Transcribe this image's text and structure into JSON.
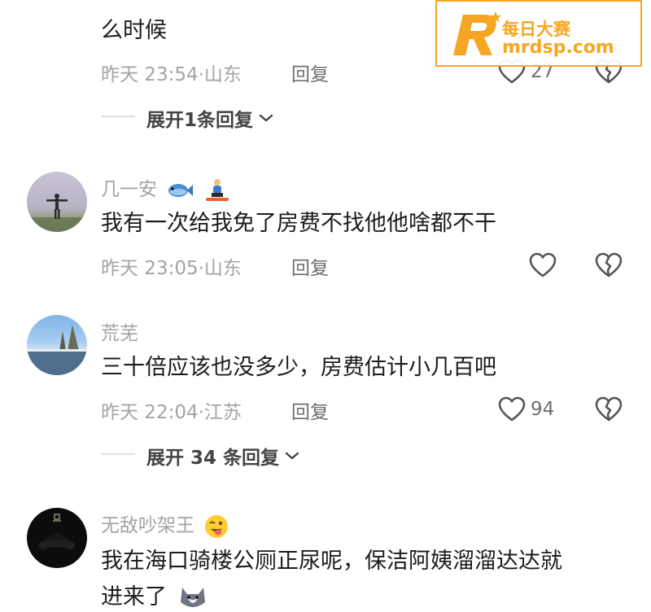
{
  "top_comment": {
    "text_line1": "",
    "text_line2": "么时候",
    "time": "昨天 23:54",
    "location": "山东",
    "reply_label": "回复",
    "likes": "27",
    "expand_label": "展开1条回复"
  },
  "comments": [
    {
      "username": "几一安",
      "text": "我有一次给我免了房费不找他他啥都不干",
      "time": "昨天 23:05",
      "location": "山东",
      "reply_label": "回复",
      "likes": ""
    },
    {
      "username": "荒芜",
      "text": "三十倍应该也没多少，房费估计小几百吧",
      "time": "昨天 22:04",
      "location": "江苏",
      "reply_label": "回复",
      "likes": "94",
      "expand_label": "展开 34 条回复"
    },
    {
      "username": "无敌吵架王",
      "text_line1": "我在海口骑楼公厕正尿呢，保洁阿姨溜溜达达就",
      "text_line2": "进来了"
    }
  ],
  "watermark": {
    "name": "每日大赛",
    "url": "mrdsp.com",
    "color": "#f5a623"
  },
  "meta_separator": "·"
}
